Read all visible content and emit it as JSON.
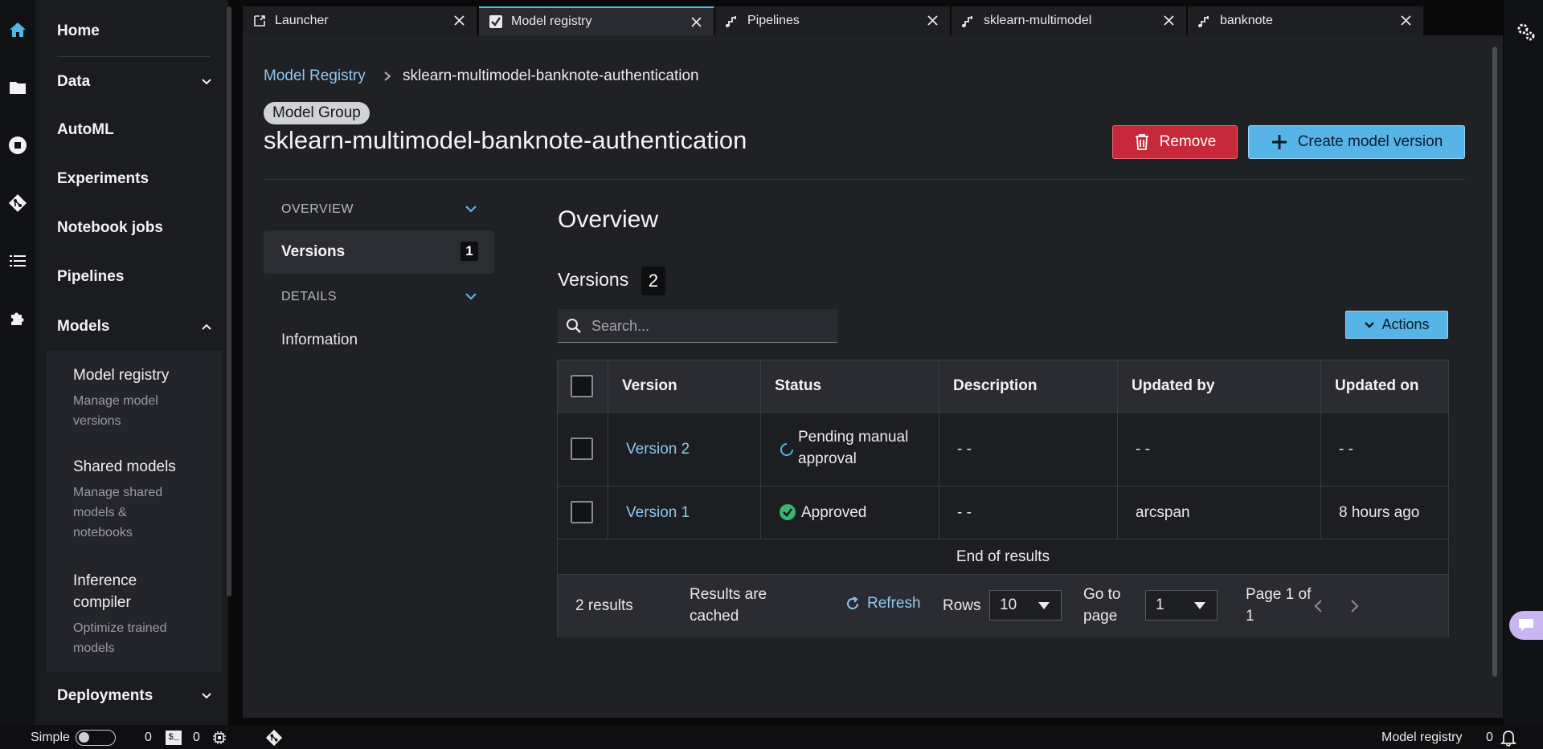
{
  "left_rail": {
    "icons": [
      "home-icon",
      "folder-icon",
      "stop-icon",
      "git-icon",
      "list-icon",
      "puzzle-icon"
    ],
    "active_color": "#4fb8e8"
  },
  "sidebar": {
    "home": "Home",
    "data": "Data",
    "automl": "AutoML",
    "experiments": "Experiments",
    "notebook_jobs": "Notebook jobs",
    "pipelines": "Pipelines",
    "models": "Models",
    "deployments": "Deployments",
    "models_sub": [
      {
        "title": "Model registry",
        "desc": "Manage model versions"
      },
      {
        "title": "Shared models",
        "desc": "Manage shared models & notebooks"
      },
      {
        "title": "Inference compiler",
        "desc": "Optimize trained models"
      }
    ]
  },
  "tabs": [
    {
      "label": "Launcher",
      "icon": "external-link-icon",
      "active": false
    },
    {
      "label": "Model registry",
      "icon": "checkbox-icon",
      "active": true
    },
    {
      "label": "Pipelines",
      "icon": "pipeline-icon",
      "active": false
    },
    {
      "label": "sklearn-multimodel",
      "icon": "pipeline-icon",
      "active": false
    },
    {
      "label": "banknote",
      "icon": "pipeline-icon",
      "active": false
    }
  ],
  "breadcrumb": {
    "root": "Model Registry",
    "current": "sklearn-multimodel-banknote-authentication"
  },
  "header": {
    "badge": "Model Group",
    "title": "sklearn-multimodel-banknote-authentication",
    "remove_label": "Remove",
    "create_label": "Create model version"
  },
  "inner_nav": {
    "overview_head": "OVERVIEW",
    "versions_label": "Versions",
    "versions_count": "1",
    "details_head": "DETAILS",
    "information": "Information"
  },
  "overview": {
    "title": "Overview",
    "versions_title": "Versions",
    "versions_count": "2",
    "search_placeholder": "Search...",
    "actions_label": "Actions"
  },
  "table": {
    "columns": [
      "Version",
      "Status",
      "Description",
      "Updated by",
      "Updated on"
    ],
    "rows": [
      {
        "version": "Version 2",
        "status_line1": "Pending manual",
        "status_line2": "approval",
        "description": "- -",
        "updated_by": "- -",
        "updated_on": "- -"
      },
      {
        "version": "Version 1",
        "status": "Approved",
        "description": "- -",
        "updated_by": "arcspan",
        "updated_on": "8 hours ago"
      }
    ],
    "end_text": "End of results",
    "footer": {
      "results": "2 results",
      "cached_1": "Results are",
      "cached_2": "cached",
      "refresh": "Refresh",
      "rows_label": "Rows",
      "rows_value": "10",
      "goto_1": "Go to",
      "goto_2": "page",
      "page_value": "1",
      "page_of_1": "Page 1 of",
      "page_of_2": "1"
    }
  },
  "status_bar": {
    "simple": "Simple",
    "count_a": "0",
    "terminal_label": "$_",
    "count_b": "0",
    "right_label": "Model registry",
    "notif_count": "0"
  }
}
